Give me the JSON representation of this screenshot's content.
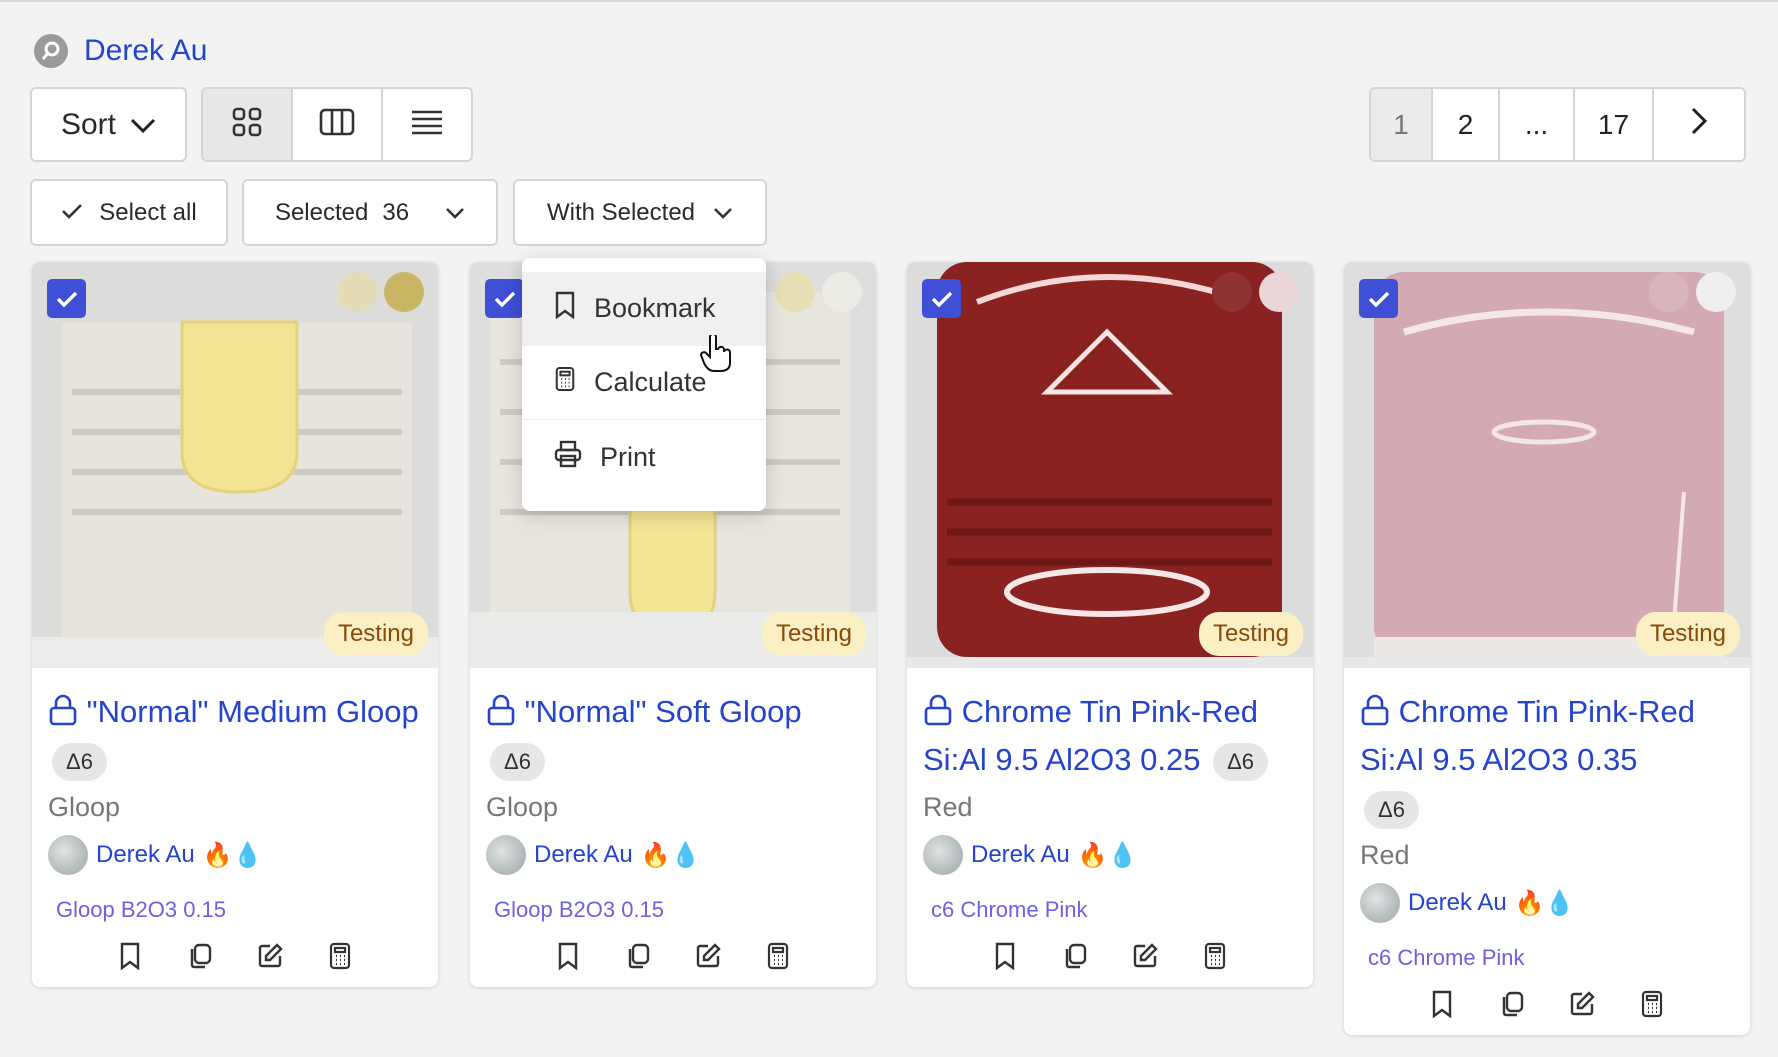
{
  "header": {
    "user_name": "Derek Au"
  },
  "toolbar": {
    "sort_label": "Sort",
    "views": [
      "grid-view-icon",
      "columns-view-icon",
      "list-view-icon"
    ],
    "pages": [
      "1",
      "2",
      "...",
      "17"
    ],
    "current_page": "1"
  },
  "selection": {
    "select_all_label": "Select all",
    "selected_label": "Selected",
    "selected_count": "36",
    "with_selected_label": "With Selected"
  },
  "menu": {
    "items": [
      {
        "label": "Bookmark",
        "icon": "bookmark-icon"
      },
      {
        "label": "Calculate",
        "icon": "calculator-icon"
      },
      {
        "label": "Print",
        "icon": "printer-icon"
      }
    ]
  },
  "cards": [
    {
      "title": "\"Normal\" Medium Gloop",
      "cone": "Δ6",
      "category": "Gloop",
      "author": "Derek Au",
      "author_badges": "🔥💧",
      "recipe": "Gloop B2O3 0.15",
      "status": "Testing",
      "swatches": [
        "#e4dcb6",
        "#c8b662"
      ]
    },
    {
      "title": "\"Normal\" Soft Gloop",
      "cone": "Δ6",
      "category": "Gloop",
      "author": "Derek Au",
      "author_badges": "🔥💧",
      "recipe": "Gloop B2O3 0.15",
      "status": "Testing",
      "swatches": [
        "#e6deb4",
        "#ecebe4"
      ]
    },
    {
      "title": "Chrome Tin Pink-Red Si:Al 9.5 Al2O3 0.25",
      "cone": "Δ6",
      "category": "Red",
      "author": "Derek Au",
      "author_badges": "🔥💧",
      "recipe": "c6 Chrome Pink",
      "status": "Testing",
      "swatches": [
        "#8e3334",
        "#ebd6d7"
      ]
    },
    {
      "title": "Chrome Tin Pink-Red Si:Al 9.5 Al2O3 0.35",
      "cone": "Δ6",
      "category": "Red",
      "author": "Derek Au",
      "author_badges": "🔥💧",
      "recipe": "c6 Chrome Pink",
      "status": "Testing",
      "swatches": [
        "#d8b4bd",
        "#f0eeee"
      ]
    }
  ],
  "colors": {
    "accent": "#2444cc",
    "checkbox": "#3f4fd6",
    "status_bg": "#fbefc4",
    "recipe": "#6b62e0"
  }
}
